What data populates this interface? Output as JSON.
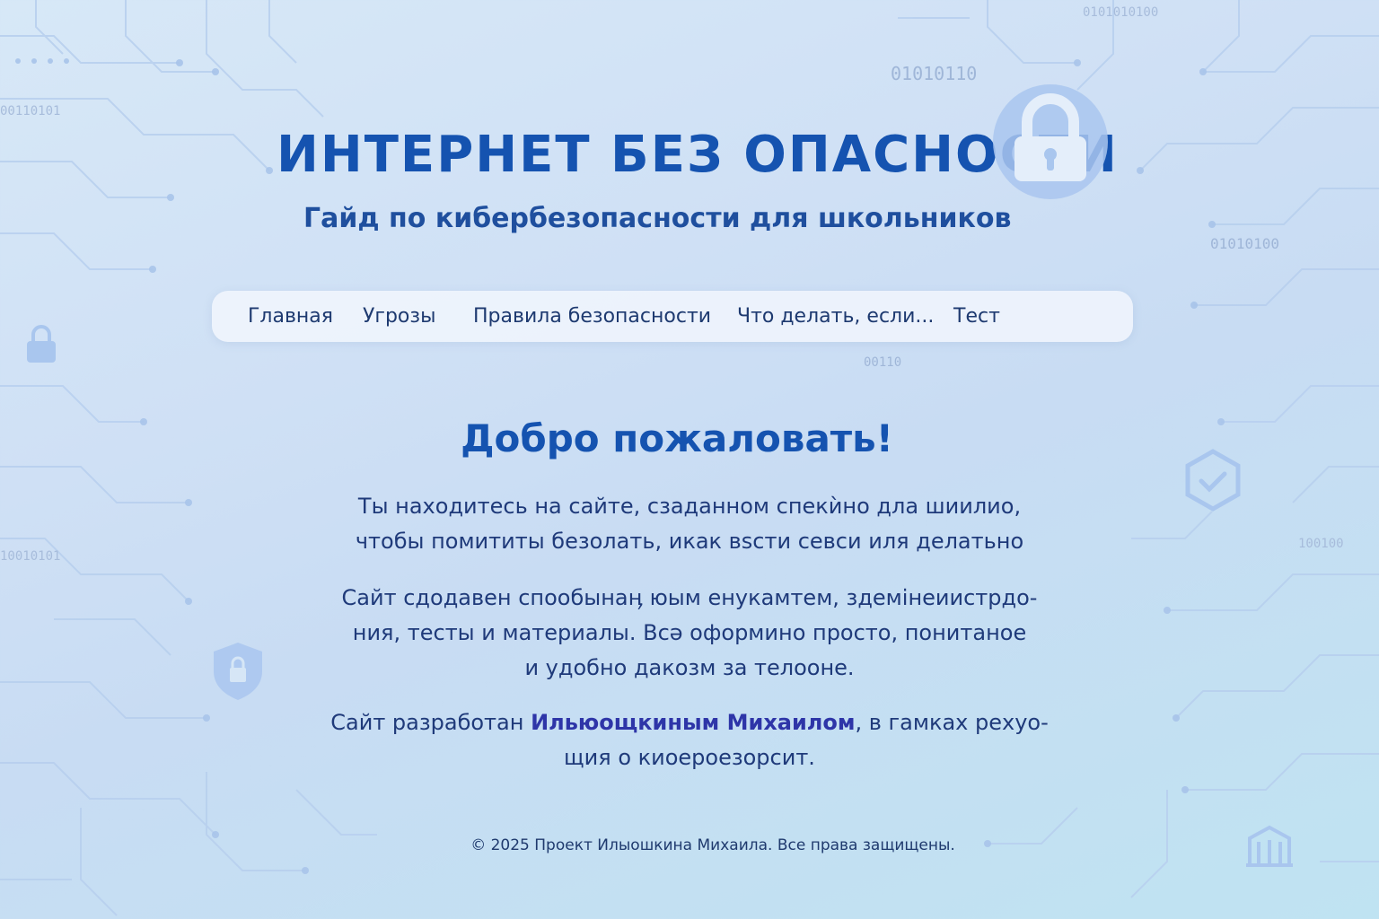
{
  "header": {
    "title": "ИНТЕРНЕТ БЕЗ ОПАСНОСТИ",
    "subtitle": "Гайд по кибербезопасности для школьников"
  },
  "nav": {
    "items": [
      {
        "label": "Главная"
      },
      {
        "label": "Угрозы"
      },
      {
        "label": "Правила безопасности"
      },
      {
        "label": "Что делать, если..."
      },
      {
        "label": "Тест"
      }
    ]
  },
  "main": {
    "welcome_title": "Добро пожаловать!",
    "paragraph1": {
      "line1": "Ты находитесь на сайте, сзаданном спекѝно дла шиилио,",
      "line2": "чтобы помититы безолать, икак вѕсти севси иля делатьно"
    },
    "paragraph2": {
      "line1": "Сайт сдодавен спообынаӊ юым енукамтем, здемінеиистрдо-",
      "line2": "ния, тесты и материалы. Всә оформино просто, понитаное",
      "line3": "и удобно дакозм за телооне."
    },
    "paragraph3": {
      "prefix": "Сайт разработан ",
      "author": "Ильюощкиным Михаилом",
      "suffix": ", в гамках рехуо-",
      "line2": "щия о киоероезорсит."
    }
  },
  "footer": {
    "text": "© 2025  Проект Илыошкина Михаила. Все права защищены."
  },
  "background": {
    "binary_snippets": [
      "01010110",
      "01010100",
      "00110",
      "00110101",
      "10010101",
      "0101010100",
      "100100"
    ]
  },
  "colors": {
    "accent": "#1553b0",
    "text": "#1f3a7a",
    "nav_bg": "#f0f5fd",
    "icon_light": "#a9c6ee"
  }
}
